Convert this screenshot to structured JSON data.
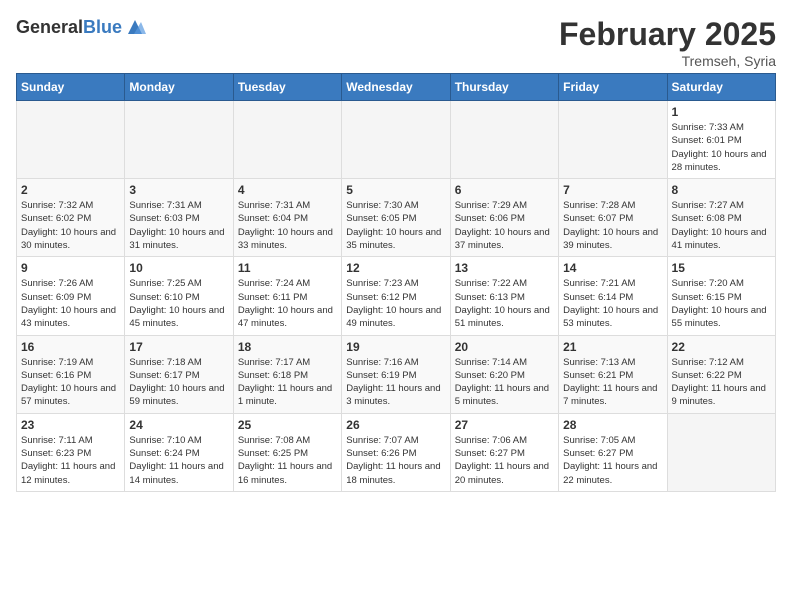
{
  "logo": {
    "general": "General",
    "blue": "Blue"
  },
  "header": {
    "month": "February 2025",
    "location": "Tremseh, Syria"
  },
  "weekdays": [
    "Sunday",
    "Monday",
    "Tuesday",
    "Wednesday",
    "Thursday",
    "Friday",
    "Saturday"
  ],
  "weeks": [
    [
      {
        "day": "",
        "info": ""
      },
      {
        "day": "",
        "info": ""
      },
      {
        "day": "",
        "info": ""
      },
      {
        "day": "",
        "info": ""
      },
      {
        "day": "",
        "info": ""
      },
      {
        "day": "",
        "info": ""
      },
      {
        "day": "1",
        "info": "Sunrise: 7:33 AM\nSunset: 6:01 PM\nDaylight: 10 hours and 28 minutes."
      }
    ],
    [
      {
        "day": "2",
        "info": "Sunrise: 7:32 AM\nSunset: 6:02 PM\nDaylight: 10 hours and 30 minutes."
      },
      {
        "day": "3",
        "info": "Sunrise: 7:31 AM\nSunset: 6:03 PM\nDaylight: 10 hours and 31 minutes."
      },
      {
        "day": "4",
        "info": "Sunrise: 7:31 AM\nSunset: 6:04 PM\nDaylight: 10 hours and 33 minutes."
      },
      {
        "day": "5",
        "info": "Sunrise: 7:30 AM\nSunset: 6:05 PM\nDaylight: 10 hours and 35 minutes."
      },
      {
        "day": "6",
        "info": "Sunrise: 7:29 AM\nSunset: 6:06 PM\nDaylight: 10 hours and 37 minutes."
      },
      {
        "day": "7",
        "info": "Sunrise: 7:28 AM\nSunset: 6:07 PM\nDaylight: 10 hours and 39 minutes."
      },
      {
        "day": "8",
        "info": "Sunrise: 7:27 AM\nSunset: 6:08 PM\nDaylight: 10 hours and 41 minutes."
      }
    ],
    [
      {
        "day": "9",
        "info": "Sunrise: 7:26 AM\nSunset: 6:09 PM\nDaylight: 10 hours and 43 minutes."
      },
      {
        "day": "10",
        "info": "Sunrise: 7:25 AM\nSunset: 6:10 PM\nDaylight: 10 hours and 45 minutes."
      },
      {
        "day": "11",
        "info": "Sunrise: 7:24 AM\nSunset: 6:11 PM\nDaylight: 10 hours and 47 minutes."
      },
      {
        "day": "12",
        "info": "Sunrise: 7:23 AM\nSunset: 6:12 PM\nDaylight: 10 hours and 49 minutes."
      },
      {
        "day": "13",
        "info": "Sunrise: 7:22 AM\nSunset: 6:13 PM\nDaylight: 10 hours and 51 minutes."
      },
      {
        "day": "14",
        "info": "Sunrise: 7:21 AM\nSunset: 6:14 PM\nDaylight: 10 hours and 53 minutes."
      },
      {
        "day": "15",
        "info": "Sunrise: 7:20 AM\nSunset: 6:15 PM\nDaylight: 10 hours and 55 minutes."
      }
    ],
    [
      {
        "day": "16",
        "info": "Sunrise: 7:19 AM\nSunset: 6:16 PM\nDaylight: 10 hours and 57 minutes."
      },
      {
        "day": "17",
        "info": "Sunrise: 7:18 AM\nSunset: 6:17 PM\nDaylight: 10 hours and 59 minutes."
      },
      {
        "day": "18",
        "info": "Sunrise: 7:17 AM\nSunset: 6:18 PM\nDaylight: 11 hours and 1 minute."
      },
      {
        "day": "19",
        "info": "Sunrise: 7:16 AM\nSunset: 6:19 PM\nDaylight: 11 hours and 3 minutes."
      },
      {
        "day": "20",
        "info": "Sunrise: 7:14 AM\nSunset: 6:20 PM\nDaylight: 11 hours and 5 minutes."
      },
      {
        "day": "21",
        "info": "Sunrise: 7:13 AM\nSunset: 6:21 PM\nDaylight: 11 hours and 7 minutes."
      },
      {
        "day": "22",
        "info": "Sunrise: 7:12 AM\nSunset: 6:22 PM\nDaylight: 11 hours and 9 minutes."
      }
    ],
    [
      {
        "day": "23",
        "info": "Sunrise: 7:11 AM\nSunset: 6:23 PM\nDaylight: 11 hours and 12 minutes."
      },
      {
        "day": "24",
        "info": "Sunrise: 7:10 AM\nSunset: 6:24 PM\nDaylight: 11 hours and 14 minutes."
      },
      {
        "day": "25",
        "info": "Sunrise: 7:08 AM\nSunset: 6:25 PM\nDaylight: 11 hours and 16 minutes."
      },
      {
        "day": "26",
        "info": "Sunrise: 7:07 AM\nSunset: 6:26 PM\nDaylight: 11 hours and 18 minutes."
      },
      {
        "day": "27",
        "info": "Sunrise: 7:06 AM\nSunset: 6:27 PM\nDaylight: 11 hours and 20 minutes."
      },
      {
        "day": "28",
        "info": "Sunrise: 7:05 AM\nSunset: 6:27 PM\nDaylight: 11 hours and 22 minutes."
      },
      {
        "day": "",
        "info": ""
      }
    ]
  ]
}
